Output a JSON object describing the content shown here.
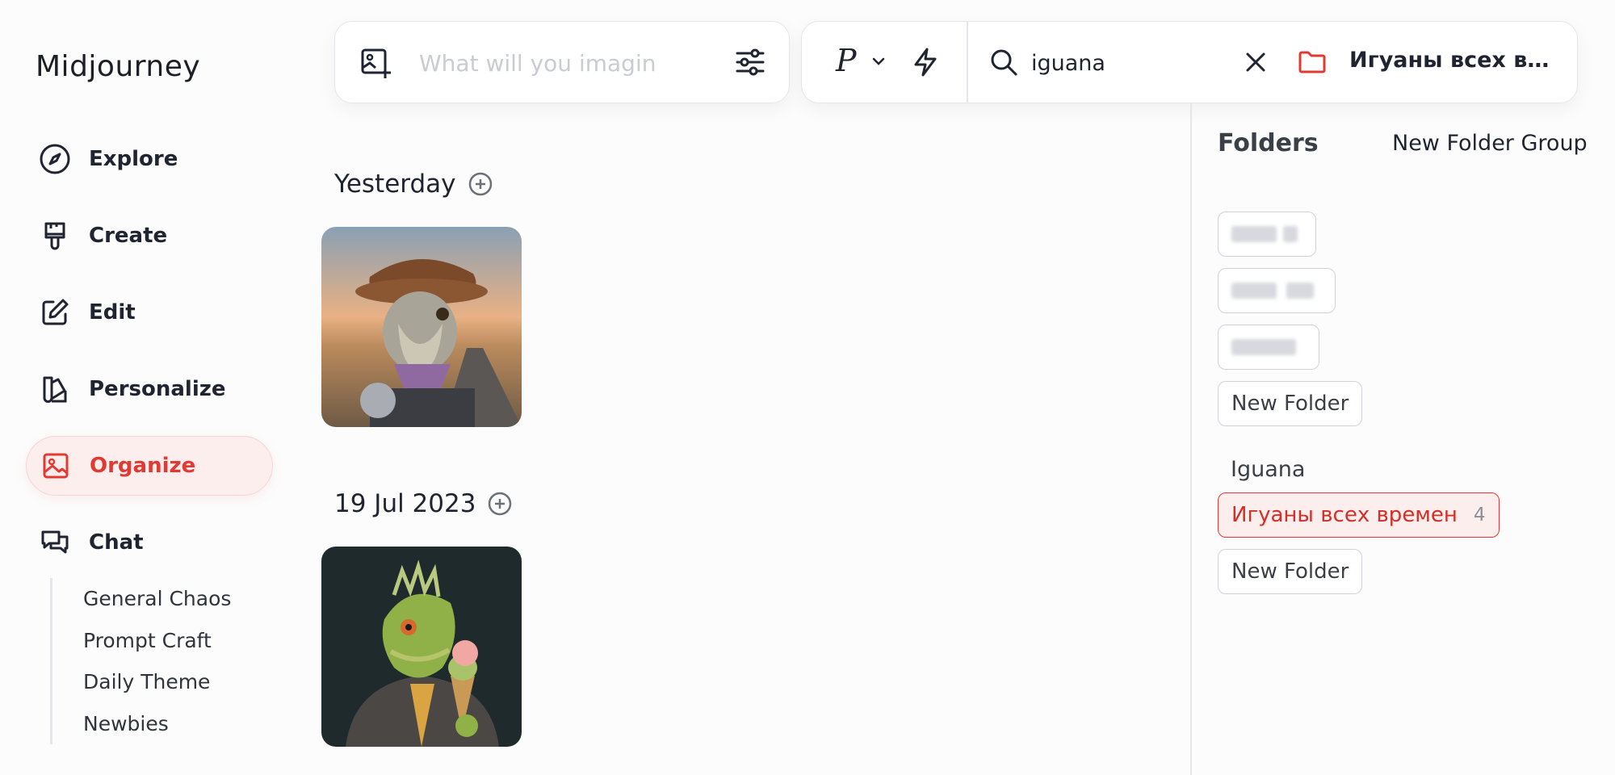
{
  "app": {
    "title": "Midjourney"
  },
  "nav": [
    {
      "label": "Explore",
      "icon": "compass-icon"
    },
    {
      "label": "Create",
      "icon": "brush-icon"
    },
    {
      "label": "Edit",
      "icon": "edit-icon"
    },
    {
      "label": "Personalize",
      "icon": "personalize-icon"
    },
    {
      "label": "Organize",
      "icon": "gallery-icon",
      "active": true
    },
    {
      "label": "Chat",
      "icon": "chat-icon"
    }
  ],
  "chat_channels": [
    "General Chaos",
    "Prompt Craft",
    "Daily Theme",
    "Newbies"
  ],
  "prompt": {
    "placeholder": "What will you imagin",
    "value": ""
  },
  "toolbar": {
    "personalize_letter": "P",
    "search_value": "iguana",
    "active_folder": "Игуаны всех времен"
  },
  "gallery": [
    {
      "date": "Yesterday",
      "images": [
        {
          "description": "iguana-cowboy-motorcycle"
        }
      ]
    },
    {
      "date": "19 Jul 2023",
      "images": [
        {
          "description": "iguana-suit-ice-cream"
        }
      ]
    }
  ],
  "folders": {
    "title": "Folders",
    "new_group_label": "New Folder Group",
    "ungrouped_new_folder": "New Folder",
    "group_name": "Iguana",
    "group_folders": [
      {
        "name": "Игуаны всех времен",
        "count": "4"
      }
    ],
    "group_new_folder": "New Folder"
  },
  "colors": {
    "accent": "#e23a32",
    "accent_bg": "#fdeeee"
  }
}
